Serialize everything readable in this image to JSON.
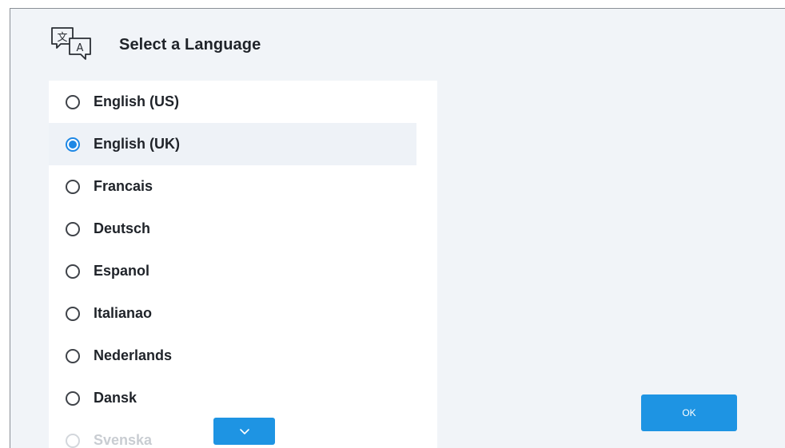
{
  "dialog": {
    "title": "Select a Language",
    "icon": "translate-icon"
  },
  "languages": [
    {
      "label": "English (US)",
      "selected": false
    },
    {
      "label": "English (UK)",
      "selected": true
    },
    {
      "label": "Francais",
      "selected": false
    },
    {
      "label": "Deutsch",
      "selected": false
    },
    {
      "label": "Espanol",
      "selected": false
    },
    {
      "label": "Italianao",
      "selected": false
    },
    {
      "label": "Nederlands",
      "selected": false
    },
    {
      "label": "Dansk",
      "selected": false
    },
    {
      "label": "Svenska",
      "selected": false
    }
  ],
  "buttons": {
    "ok_label": "OK",
    "scroll_icon": "chevron-down-icon"
  },
  "colors": {
    "accent": "#1e94e3",
    "background": "#f1f4f8",
    "text": "#1f2329"
  }
}
